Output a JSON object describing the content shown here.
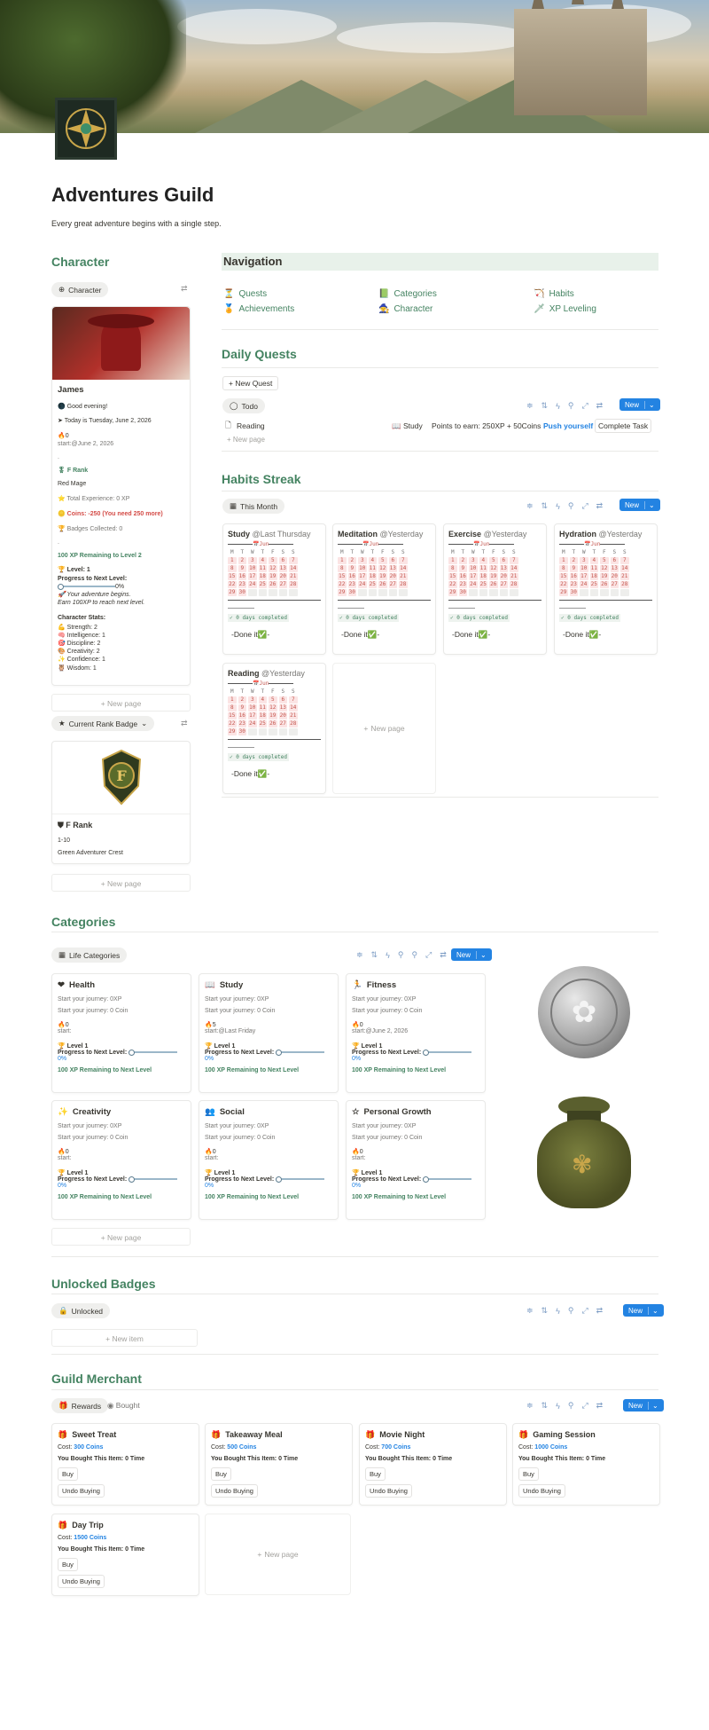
{
  "page": {
    "title": "Adventures Guild",
    "subtitle": "Every great adventure begins with a single step."
  },
  "character": {
    "heading": "Character",
    "view_chip": "Character",
    "name": "James",
    "greeting": "Good evening!",
    "today": "Today is Tuesday, June 2, 2026",
    "streak": "🔥0",
    "start": "start:@June 2, 2026",
    "rank": "F Rank",
    "class": "Red Mage",
    "total_xp": "Total Experience: 0 XP",
    "coins": "Coins: -250 (You need 250 more)",
    "badges": "Badges Collected: 0",
    "xp_remaining": "100 XP Remaining to Level 2",
    "level": "Level: 1",
    "progress_label": "Progress to Next Level:",
    "progress_pct": "0%",
    "adventure1": "Your adventure begins.",
    "adventure2": "Earn 100XP to reach next level.",
    "stats_heading": "Character Stats:",
    "stats": [
      "Strength: 2",
      "Intelligence: 1",
      "Discipline: 2",
      "Creativity: 2",
      "Confidence: 1",
      "Wisdom: 1"
    ],
    "new_page": "New page"
  },
  "badge_section": {
    "chip": "Current Rank Badge",
    "badge_letter": "F",
    "rank": "F Rank",
    "range": "1-10",
    "crest": "Green Adventurer Crest",
    "new_page": "New page"
  },
  "navigation": {
    "heading": "Navigation",
    "links": [
      {
        "icon": "⏳",
        "label": "Quests"
      },
      {
        "icon": "📗",
        "label": "Categories"
      },
      {
        "icon": "🏹",
        "label": "Habits"
      },
      {
        "icon": "🏅",
        "label": "Achievements"
      },
      {
        "icon": "🧙",
        "label": "Character"
      },
      {
        "icon": "🗡",
        "label": "XP Leveling"
      }
    ]
  },
  "daily_quests": {
    "heading": "Daily Quests",
    "new_quest": "New Quest",
    "view_chip": "Todo",
    "new_btn": "New",
    "row": {
      "name": "Reading",
      "category": "Study",
      "points": "Points to earn: 250XP + 50Coins",
      "push": "Push yourself",
      "complete": "Complete Task"
    },
    "new_page": "New page"
  },
  "habits": {
    "heading": "Habits Streak",
    "view_chip": "This Month",
    "new_btn": "New",
    "cal_month": "📅Jun",
    "cal_days": [
      "M",
      "T",
      "W",
      "T",
      "F",
      "S",
      "S"
    ],
    "cal_rows": [
      [
        "",
        "1",
        "2",
        "3",
        "4",
        "5",
        "6",
        "7"
      ],
      [
        "8",
        "9",
        "10",
        "11",
        "12",
        "13",
        "14"
      ],
      [
        "15",
        "16",
        "17",
        "18",
        "19",
        "20",
        "21"
      ],
      [
        "22",
        "23",
        "24",
        "25",
        "26",
        "27",
        "28"
      ],
      [
        "29",
        "30",
        "",
        "",
        "",
        "",
        ""
      ]
    ],
    "completed": "✓ 0 days completed",
    "done": "-Done it✅-",
    "items": [
      {
        "name": "Study",
        "when": "@Last Thursday"
      },
      {
        "name": "Meditation",
        "when": "@Yesterday"
      },
      {
        "name": "Exercise",
        "when": "@Yesterday"
      },
      {
        "name": "Hydration",
        "when": "@Yesterday"
      },
      {
        "name": "Reading",
        "when": "@Yesterday"
      }
    ],
    "new_page": "New page"
  },
  "categories": {
    "heading": "Categories",
    "view_chip": "Life Categories",
    "new_btn": "New",
    "journey_xp": "Start your journey: 0XP",
    "journey_coin": "Start your journey: 0 Coin",
    "level": "Level 1",
    "progress_label": "Progress to Next Level:",
    "pct": "0%",
    "remaining": "100 XP Remaining to Next Level",
    "items": [
      {
        "icon": "❤",
        "name": "Health",
        "streak": "🔥0",
        "start": "start:"
      },
      {
        "icon": "📖",
        "name": "Study",
        "streak": "🔥5",
        "start": "start:@Last Friday"
      },
      {
        "icon": "🏃",
        "name": "Fitness",
        "streak": "🔥0",
        "start": "start:@June 2, 2026"
      },
      {
        "icon": "✨",
        "name": "Creativity",
        "streak": "🔥0",
        "start": "start:"
      },
      {
        "icon": "👥",
        "name": "Social",
        "streak": "🔥0",
        "start": "start:"
      },
      {
        "icon": "☆",
        "name": "Personal Growth",
        "streak": "🔥0",
        "start": "start:"
      }
    ],
    "new_page": "New page"
  },
  "unlocked": {
    "heading": "Unlocked Badges",
    "view_chip": "Unlocked",
    "new_btn": "New",
    "new_item": "New item"
  },
  "merchant": {
    "heading": "Guild Merchant",
    "tabs": [
      "Rewards",
      "Bought"
    ],
    "new_btn": "New",
    "cost_label": "Cost:",
    "bought": "You Bought This Item: 0 Time",
    "buy": "Buy",
    "undo": "Undo Buying",
    "items": [
      {
        "name": "Sweet Treat",
        "cost": "300 Coins"
      },
      {
        "name": "Takeaway Meal",
        "cost": "500 Coins"
      },
      {
        "name": "Movie Night",
        "cost": "700 Coins"
      },
      {
        "name": "Gaming Session",
        "cost": "1000 Coins"
      },
      {
        "name": "Day Trip",
        "cost": "1500 Coins"
      }
    ],
    "new_page": "New page"
  },
  "colors": {
    "accent": "#448361",
    "link_blue": "#2383e2",
    "warning": "#d44c47"
  }
}
